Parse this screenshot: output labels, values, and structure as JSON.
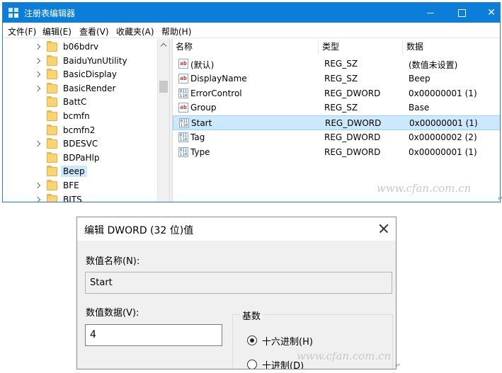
{
  "regedit": {
    "title": "注册表编辑器",
    "menu": [
      "文件(F)",
      "编辑(E)",
      "查看(V)",
      "收藏夹(A)",
      "帮助(H)"
    ],
    "tree_items": [
      {
        "label": "b06bdrv",
        "expandable": true
      },
      {
        "label": "BaiduYunUtility",
        "expandable": true
      },
      {
        "label": "BasicDisplay",
        "expandable": true
      },
      {
        "label": "BasicRender",
        "expandable": true
      },
      {
        "label": "BattC",
        "expandable": false
      },
      {
        "label": "bcmfn",
        "expandable": false
      },
      {
        "label": "bcmfn2",
        "expandable": false
      },
      {
        "label": "BDESVC",
        "expandable": true
      },
      {
        "label": "BDPaHlp",
        "expandable": false
      },
      {
        "label": "Beep",
        "expandable": false,
        "selected": true
      },
      {
        "label": "BFE",
        "expandable": true
      },
      {
        "label": "BITS",
        "expandable": true
      }
    ],
    "columns": {
      "name": "名称",
      "type": "类型",
      "data": "数据"
    },
    "values": [
      {
        "icon": "string-value-icon",
        "name": "(默认)",
        "type": "REG_SZ",
        "data": "(数值未设置)"
      },
      {
        "icon": "string-value-icon",
        "name": "DisplayName",
        "type": "REG_SZ",
        "data": "Beep"
      },
      {
        "icon": "binary-value-icon",
        "name": "ErrorControl",
        "type": "REG_DWORD",
        "data": "0x00000001 (1)"
      },
      {
        "icon": "string-value-icon",
        "name": "Group",
        "type": "REG_SZ",
        "data": "Base"
      },
      {
        "icon": "binary-value-icon",
        "name": "Start",
        "type": "REG_DWORD",
        "data": "0x00000001 (1)",
        "selected": true
      },
      {
        "icon": "binary-value-icon",
        "name": "Tag",
        "type": "REG_DWORD",
        "data": "0x00000002 (2)"
      },
      {
        "icon": "binary-value-icon",
        "name": "Type",
        "type": "REG_DWORD",
        "data": "0x00000001 (1)"
      }
    ]
  },
  "dialog": {
    "title": "编辑 DWORD (32 位)值",
    "name_label": "数值名称(N):",
    "name_value": "Start",
    "data_label": "数值数据(V):",
    "data_value": "4",
    "base_label": "基数",
    "hex_label": "十六进制(H)",
    "dec_label": "十进制(D)",
    "selected_base": "hex"
  },
  "watermark": "www.cfan.com.cn",
  "colors": {
    "titlebar": "#0a7ed8",
    "selection": "#cce8ff",
    "dialog_bg": "#f0f0f0"
  }
}
